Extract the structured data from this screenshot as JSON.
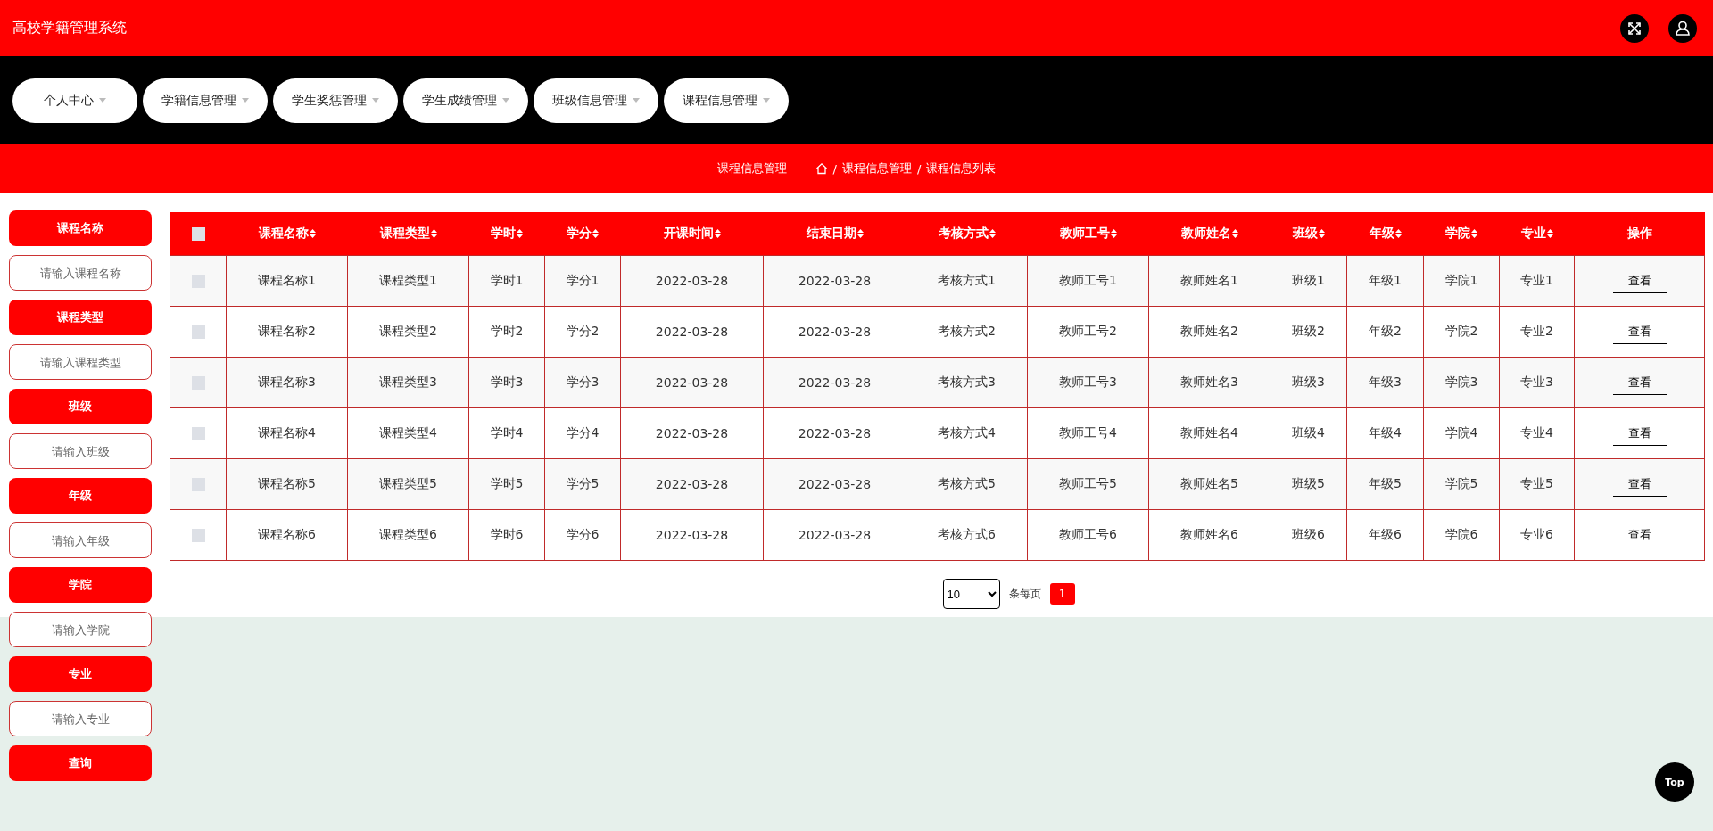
{
  "header": {
    "title": "高校学籍管理系统"
  },
  "nav": [
    {
      "label": "个人中心"
    },
    {
      "label": "学籍信息管理"
    },
    {
      "label": "学生奖惩管理"
    },
    {
      "label": "学生成绩管理"
    },
    {
      "label": "班级信息管理"
    },
    {
      "label": "课程信息管理"
    }
  ],
  "breadcrumb": {
    "title": "课程信息管理",
    "separator": "/",
    "path": [
      "课程信息管理",
      "课程信息列表"
    ]
  },
  "filters": [
    {
      "label": "课程名称",
      "placeholder": "请输入课程名称"
    },
    {
      "label": "课程类型",
      "placeholder": "请输入课程类型"
    },
    {
      "label": "班级",
      "placeholder": "请输入班级"
    },
    {
      "label": "年级",
      "placeholder": "请输入年级"
    },
    {
      "label": "学院",
      "placeholder": "请输入学院"
    },
    {
      "label": "专业",
      "placeholder": "请输入专业"
    }
  ],
  "search_button": "查询",
  "table": {
    "select_all_checked": false,
    "columns": [
      {
        "label": "课程名称",
        "sortable": true
      },
      {
        "label": "课程类型",
        "sortable": true
      },
      {
        "label": "学时",
        "sortable": true
      },
      {
        "label": "学分",
        "sortable": true
      },
      {
        "label": "开课时间",
        "sortable": true
      },
      {
        "label": "结束日期",
        "sortable": true
      },
      {
        "label": "考核方式",
        "sortable": true
      },
      {
        "label": "教师工号",
        "sortable": true
      },
      {
        "label": "教师姓名",
        "sortable": true
      },
      {
        "label": "班级",
        "sortable": true
      },
      {
        "label": "年级",
        "sortable": true
      },
      {
        "label": "学院",
        "sortable": true
      },
      {
        "label": "专业",
        "sortable": true
      },
      {
        "label": "操作",
        "sortable": false
      }
    ],
    "rows": [
      {
        "checked": false,
        "cells": [
          "课程名称1",
          "课程类型1",
          "学时1",
          "学分1",
          "2022-03-28",
          "2022-03-28",
          "考核方式1",
          "教师工号1",
          "教师姓名1",
          "班级1",
          "年级1",
          "学院1",
          "专业1"
        ],
        "action": "查看"
      },
      {
        "checked": false,
        "cells": [
          "课程名称2",
          "课程类型2",
          "学时2",
          "学分2",
          "2022-03-28",
          "2022-03-28",
          "考核方式2",
          "教师工号2",
          "教师姓名2",
          "班级2",
          "年级2",
          "学院2",
          "专业2"
        ],
        "action": "查看"
      },
      {
        "checked": false,
        "cells": [
          "课程名称3",
          "课程类型3",
          "学时3",
          "学分3",
          "2022-03-28",
          "2022-03-28",
          "考核方式3",
          "教师工号3",
          "教师姓名3",
          "班级3",
          "年级3",
          "学院3",
          "专业3"
        ],
        "action": "查看"
      },
      {
        "checked": false,
        "cells": [
          "课程名称4",
          "课程类型4",
          "学时4",
          "学分4",
          "2022-03-28",
          "2022-03-28",
          "考核方式4",
          "教师工号4",
          "教师姓名4",
          "班级4",
          "年级4",
          "学院4",
          "专业4"
        ],
        "action": "查看"
      },
      {
        "checked": false,
        "cells": [
          "课程名称5",
          "课程类型5",
          "学时5",
          "学分5",
          "2022-03-28",
          "2022-03-28",
          "考核方式5",
          "教师工号5",
          "教师姓名5",
          "班级5",
          "年级5",
          "学院5",
          "专业5"
        ],
        "action": "查看"
      },
      {
        "checked": false,
        "cells": [
          "课程名称6",
          "课程类型6",
          "学时6",
          "学分6",
          "2022-03-28",
          "2022-03-28",
          "考核方式6",
          "教师工号6",
          "教师姓名6",
          "班级6",
          "年级6",
          "学院6",
          "专业6"
        ],
        "action": "查看"
      }
    ]
  },
  "pagination": {
    "page_size": "10",
    "per_page_label": "条每页",
    "pages": [
      {
        "label": "1",
        "selected": true
      }
    ]
  },
  "back_to_top": "Top"
}
